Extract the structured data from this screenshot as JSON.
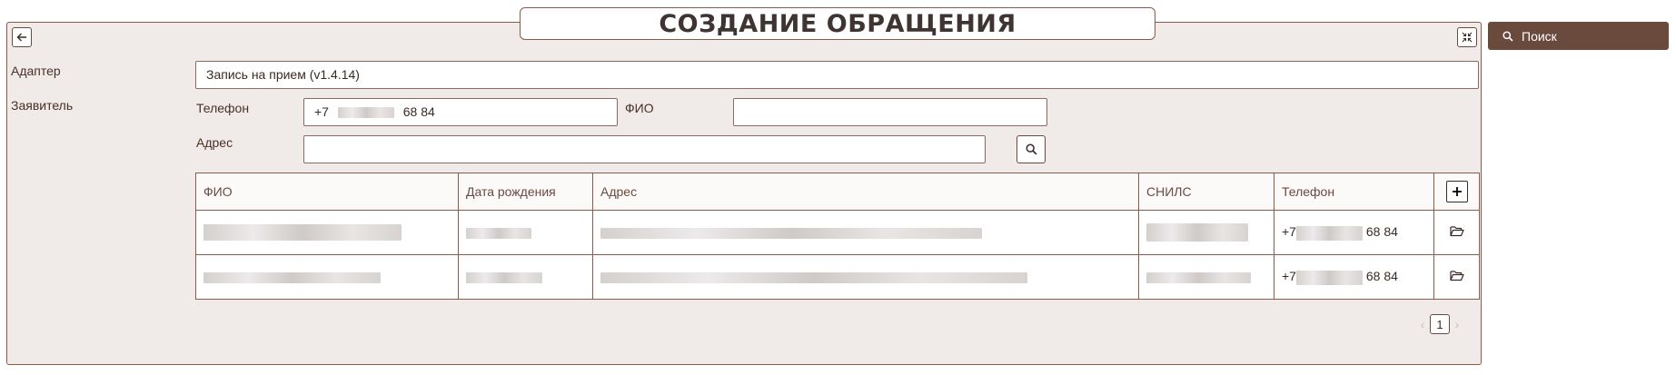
{
  "page_title": "СОЗДАНИЕ ОБРАЩЕНИЯ",
  "sidebar": {
    "search_label": "Поиск"
  },
  "form": {
    "adapter_label": "Адаптер",
    "adapter_value": "Запись на прием (v1.4.14)",
    "applicant_label": "Заявитель",
    "phone_label": "Телефон",
    "phone_prefix": "+7",
    "phone_suffix": "68 84",
    "fio_label": "ФИО",
    "fio_value": "",
    "address_label": "Адрес",
    "address_value": ""
  },
  "table": {
    "headers": [
      "ФИО",
      "Дата рождения",
      "Адрес",
      "СНИЛС",
      "Телефон"
    ],
    "rows": [
      {
        "phone_prefix": "+7",
        "phone_suffix": "68 84"
      },
      {
        "phone_prefix": "+7",
        "phone_suffix": "68 84"
      }
    ]
  },
  "pagination": {
    "current_page": "1"
  },
  "icons": {
    "back": "arrow-left-icon",
    "fullscreen": "collapse-icon",
    "search": "magnifier-icon",
    "add": "plus-icon",
    "open": "folder-open-icon"
  },
  "colors": {
    "panel_bg": "#f0ebe8",
    "border": "#8a5a4a",
    "accent_button": "#6b4a3e",
    "text": "#4a3026"
  }
}
